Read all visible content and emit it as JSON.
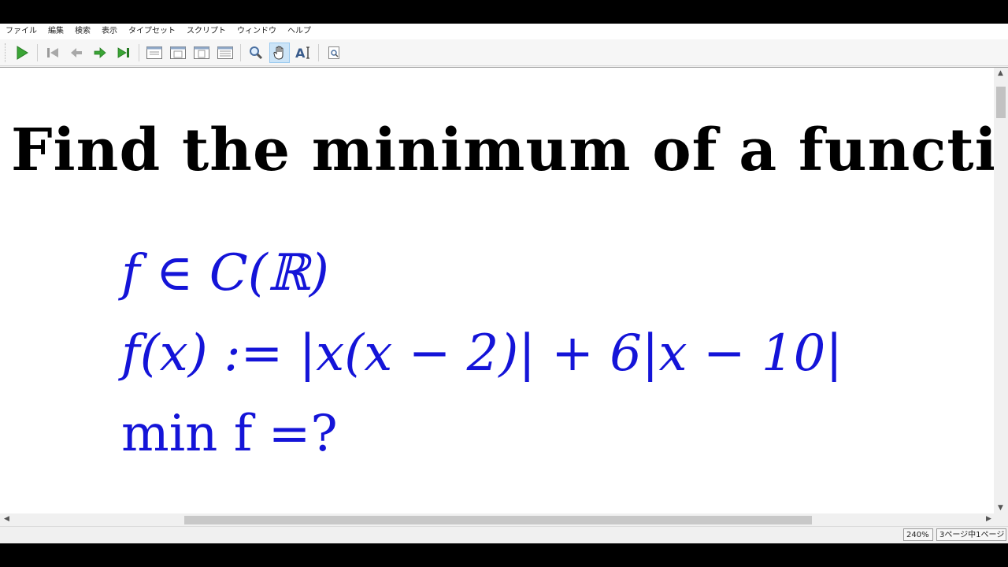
{
  "menu": [
    "ファイル",
    "編集",
    "検索",
    "表示",
    "タイプセット",
    "スクリプト",
    "ウィンドウ",
    "ヘルプ"
  ],
  "toolbar": {
    "icons": [
      "typeset-icon",
      "first-page-icon",
      "previous-page-icon",
      "next-page-icon",
      "last-page-icon",
      "view-single-page-icon",
      "view-continuous-icon",
      "view-fit-width-icon",
      "view-facing-icon",
      "magnifier-icon",
      "hand-tool-icon",
      "text-select-icon",
      "find-icon"
    ],
    "active_tool": "hand-tool-icon"
  },
  "document": {
    "title": "Find the minimum of a function",
    "line1": "f ∈ C(ℝ)",
    "line2": "f(x) := |x(x − 2)| + 6|x − 10|",
    "line3": "min f =?"
  },
  "status": {
    "zoom": "240%",
    "page": "3ページ中1ページ"
  },
  "colors": {
    "math_text": "#1414d8",
    "title_text": "#000000"
  }
}
